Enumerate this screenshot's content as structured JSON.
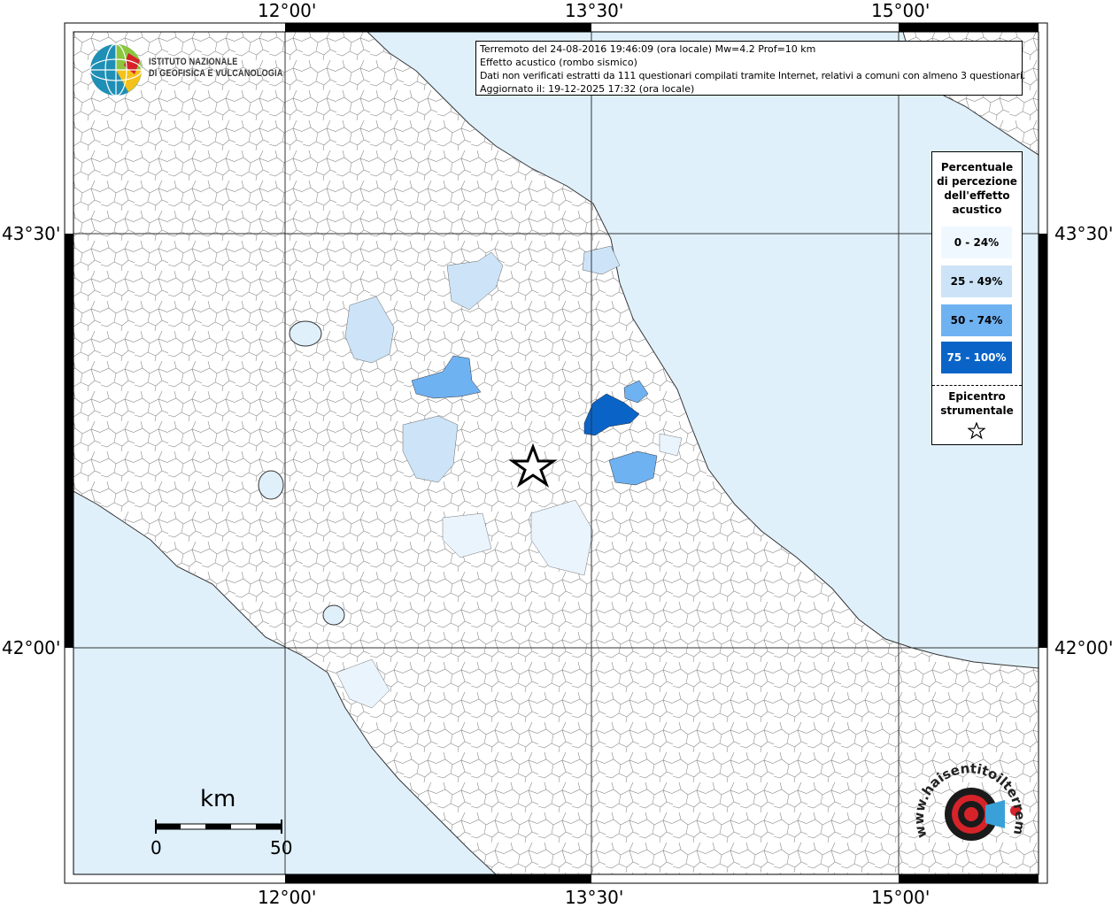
{
  "info": {
    "line1": "Terremoto del 24-08-2016 19:46:09 (ora locale) Mw=4.2 Prof=10 km",
    "line2": "Effetto acustico (rombo sismico)",
    "line3": "Dati non verificati estratti da 111 questionari compilati tramite Internet, relativi a comuni con almeno 3 questionari.",
    "line4": "Aggiornato il: 19-12-2025 17:32 (ora locale)"
  },
  "axes": {
    "top": [
      "12°00'",
      "13°30'",
      "15°00'"
    ],
    "bottom": [
      "12°00'",
      "13°30'",
      "15°00'"
    ],
    "left": [
      "43°30'",
      "42°00'"
    ],
    "right": [
      "43°30'",
      "42°00'"
    ]
  },
  "legend": {
    "title_lines": [
      "Percentuale",
      "di percezione",
      "dell'effetto",
      "acustico"
    ],
    "classes": [
      {
        "label": "0 - 24%",
        "color": "#f0f8ff",
        "text_color": "#000000"
      },
      {
        "label": "25 - 49%",
        "color": "#cde4f8",
        "text_color": "#000000"
      },
      {
        "label": "50 - 74%",
        "color": "#6fb2f2",
        "text_color": "#000000"
      },
      {
        "label": "75 - 100%",
        "color": "#0a64c8",
        "text_color": "#ffffff"
      }
    ],
    "epicenter_lines": [
      "Epicentro",
      "strumentale"
    ]
  },
  "logo": {
    "institute_lines": [
      "ISTITUTO NAZIONALE",
      "DI GEOFISICA E VULCANOLOGIA"
    ],
    "hsit_text": "www.haisentitoilterremoto.it"
  },
  "scale": {
    "unit": "km",
    "start": "0",
    "end": "50"
  },
  "colors": {
    "sea": "#dff0fb",
    "land": "#ffffff",
    "border": "#000000"
  }
}
